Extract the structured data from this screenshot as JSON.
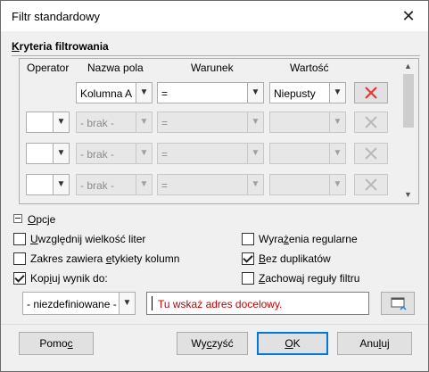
{
  "window": {
    "title": "Filtr standardowy",
    "close_glyph": "✕"
  },
  "criteria": {
    "section_title_pre": "",
    "section_title_underline": "K",
    "section_title_rest": "ryteria filtrowania",
    "headers": {
      "operator": "Operator",
      "field": "Nazwa pola",
      "condition": "Warunek",
      "value": "Wartość"
    },
    "rows": [
      {
        "operator": "",
        "field": "Kolumna A",
        "condition": "=",
        "value": "Niepusty",
        "enabled": true
      },
      {
        "operator": "",
        "field": "- brak -",
        "condition": "=",
        "value": "",
        "enabled": false
      },
      {
        "operator": "",
        "field": "- brak -",
        "condition": "=",
        "value": "",
        "enabled": false
      },
      {
        "operator": "",
        "field": "- brak -",
        "condition": "=",
        "value": "",
        "enabled": false
      }
    ]
  },
  "options": {
    "toggle_label_underline": "O",
    "toggle_label_rest": "pcje",
    "case_sensitive": {
      "pre": "",
      "u": "U",
      "post": "względnij wielkość liter",
      "checked": false
    },
    "regex": {
      "pre": "Wyra",
      "u": "ż",
      "post": "enia regularne",
      "checked": false
    },
    "range_labels": {
      "pre": "Zakres zawiera ",
      "u": "e",
      "post": "tykiety kolumn",
      "checked": false
    },
    "no_duplicates": {
      "pre": "",
      "u": "B",
      "post": "ez duplikatów",
      "checked": true
    },
    "copy_results": {
      "pre": "Kop",
      "u": "i",
      "post": "uj wynik do:",
      "checked": true
    },
    "keep_criteria": {
      "pre": "",
      "u": "Z",
      "post": "achowaj reguły filtru",
      "checked": false
    },
    "destination_select": "- niezdefiniowane -",
    "destination_placeholder": "Tu wskaż adres docelowy."
  },
  "buttons": {
    "help": {
      "pre": "Pomo",
      "u": "c",
      "post": ""
    },
    "clear": {
      "pre": "Wy",
      "u": "c",
      "post": "zyść"
    },
    "ok": {
      "pre": "",
      "u": "O",
      "post": "K"
    },
    "cancel": {
      "pre": "Anu",
      "u": "l",
      "post": "uj"
    }
  },
  "colors": {
    "delete_active": "#e53935",
    "delete_disabled": "#b9b9b9",
    "placeholder": "#c00000",
    "accent": "#0078d7"
  },
  "icons": {
    "delete": "x-delete-icon",
    "shrink": "shrink-dialog-icon",
    "collapse": "collapse-minus-icon"
  }
}
